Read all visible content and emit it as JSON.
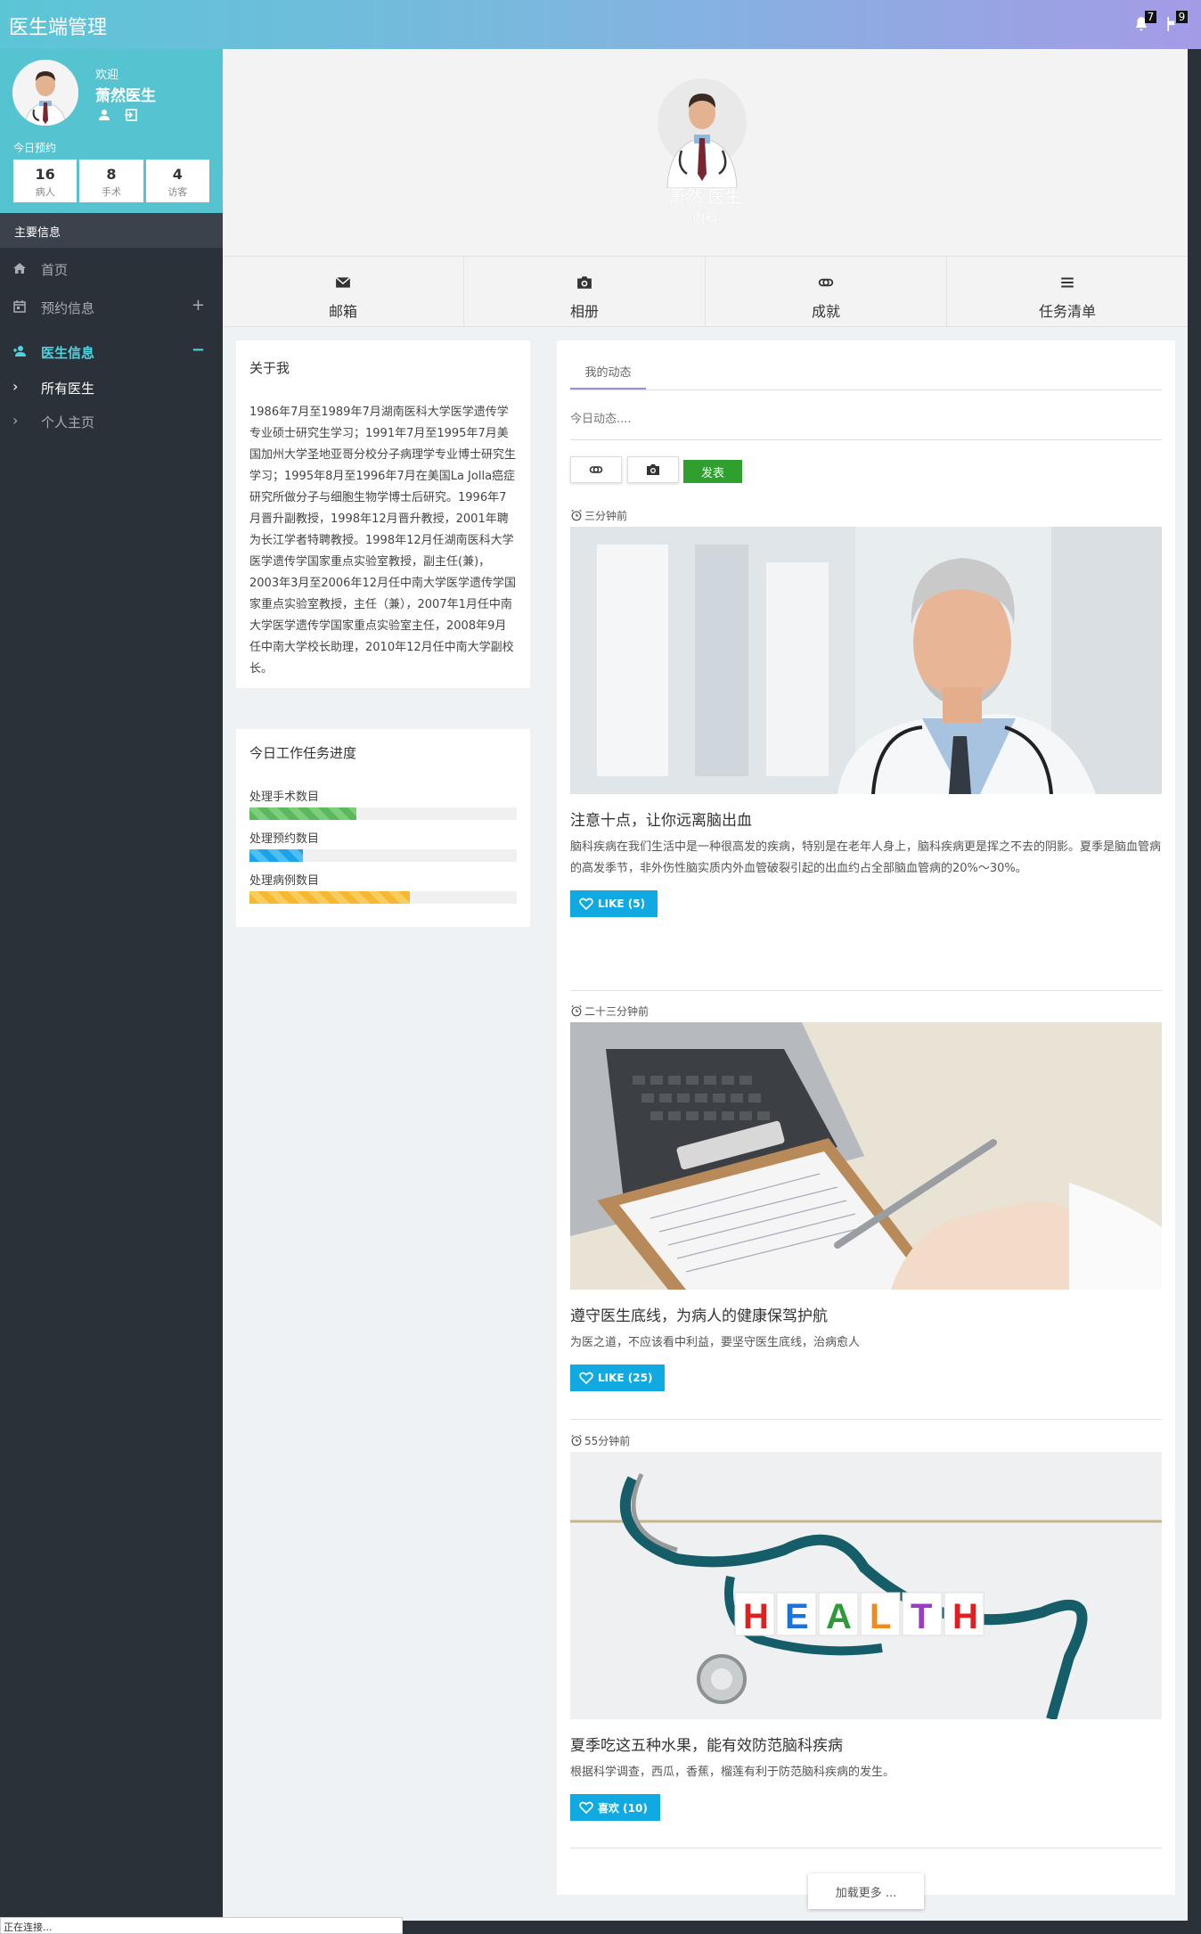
{
  "app": {
    "title": "医生端管理"
  },
  "topbar": {
    "notifications_count": "7",
    "flags_count": "9"
  },
  "profile": {
    "welcome": "欢迎",
    "name": "萧然医生",
    "today_label": "今日预约",
    "stats": [
      {
        "value": "16",
        "label": "病人"
      },
      {
        "value": "8",
        "label": "手术"
      },
      {
        "value": "4",
        "label": "访客"
      }
    ]
  },
  "sidebar": {
    "section_title": "主要信息",
    "items": [
      {
        "label": "首页",
        "icon": "home-icon"
      },
      {
        "label": "预约信息",
        "icon": "calendar-icon",
        "right": "+"
      },
      {
        "label": "医生信息",
        "icon": "user-add-icon",
        "right": "−"
      }
    ],
    "sub_items": [
      {
        "label": "所有医生"
      },
      {
        "label": "个人主页"
      }
    ]
  },
  "header": {
    "name": "萧然 医生",
    "dept": "内科"
  },
  "tabs": [
    {
      "label": "邮箱",
      "icon": "mail-icon"
    },
    {
      "label": "相册",
      "icon": "camera-icon"
    },
    {
      "label": "成就",
      "icon": "link-icon"
    },
    {
      "label": "任务清单",
      "icon": "list-icon"
    }
  ],
  "about": {
    "title": "关于我",
    "text": "1986年7月至1989年7月湖南医科大学医学遗传学专业硕士研究生学习；1991年7月至1995年7月美国加州大学圣地亚哥分校分子病理学专业博士研究生学习；1995年8月至1996年7月在美国La Jolla癌症研究所做分子与细胞生物学博士后研究。1996年7月晋升副教授，1998年12月晋升教授，2001年聘为长江学者特聘教授。1998年12月任湖南医科大学医学遗传学国家重点实验室教授，副主任(兼)，2003年3月至2006年12月任中南大学医学遗传学国家重点实验室教授，主任（兼），2007年1月任中南大学医学遗传学国家重点实验室主任，2008年9月任中南大学校长助理，2010年12月任中南大学副校长。"
  },
  "progress": {
    "title": "今日工作任务进度",
    "items": [
      {
        "label": "处理手术数目",
        "value": 0.4,
        "color": "#5cb85c"
      },
      {
        "label": "处理预约数目",
        "value": 0.2,
        "color": "#1aa3e8"
      },
      {
        "label": "处理病例数目",
        "value": 0.6,
        "color": "#f5b82e"
      }
    ]
  },
  "feed": {
    "tab_label": "我的动态",
    "input_placeholder": "今日动态....",
    "publish_label": "发表",
    "posts": [
      {
        "time": "三分钟前",
        "title": "注意十点，让你远离脑出血",
        "body": "脑科疾病在我们生活中是一种很高发的疾病，特别是在老年人身上，脑科疾病更是挥之不去的阴影。夏季是脑血管病的高发季节，非外伤性脑实质内外血管破裂引起的出血约占全部脑血管病的20%～30%。",
        "like": "LIKE (5)"
      },
      {
        "time": "二十三分钟前",
        "title": "遵守医生底线，为病人的健康保驾护航",
        "body": "为医之道，不应该看中利益，要坚守医生底线，治病愈人",
        "like": "LIKE (25)"
      },
      {
        "time": "55分钟前",
        "title": "夏季吃这五种水果，能有效防范脑科疾病",
        "body": "根据科学调查，西瓜，香蕉，榴莲有利于防范脑科疾病的发生。",
        "like": "喜欢 (10)"
      }
    ],
    "health_letters": [
      "H",
      "E",
      "A",
      "L",
      "T",
      "H"
    ],
    "load_more": "加载更多 ..."
  },
  "status_bar": "正在连接..."
}
